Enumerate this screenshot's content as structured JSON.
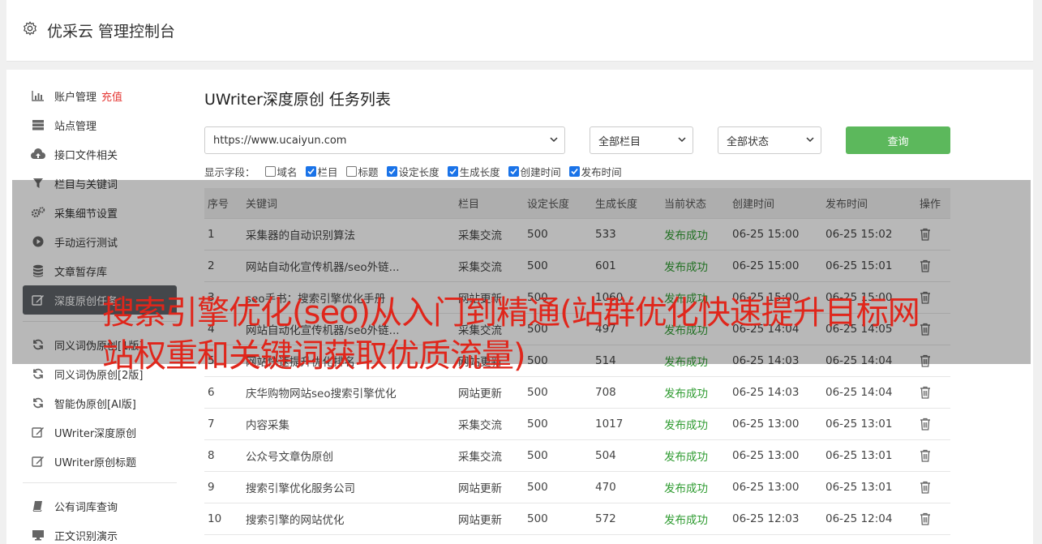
{
  "app": {
    "title": "优采云 管理控制台"
  },
  "sidebar": {
    "items": [
      {
        "label": "账户管理",
        "extra": "充值",
        "icon": "bar-chart-icon"
      },
      {
        "label": "站点管理",
        "icon": "server-icon"
      },
      {
        "label": "接口文件相关",
        "icon": "cloud-upload-icon"
      },
      {
        "label": "栏目与关键词",
        "icon": "filter-icon"
      },
      {
        "label": "采集细节设置",
        "icon": "gears-icon"
      },
      {
        "label": "手动运行测试",
        "icon": "play-circle-icon"
      },
      {
        "label": "文章暂存库",
        "icon": "database-icon"
      },
      {
        "label": "深度原创任务",
        "icon": "edit-icon"
      },
      {
        "label": "同义词伪原创[1版]",
        "icon": "refresh-icon"
      },
      {
        "label": "同义词伪原创[2版]",
        "icon": "refresh-icon"
      },
      {
        "label": "智能伪原创[AI版]",
        "icon": "refresh-icon"
      },
      {
        "label": "UWriter深度原创",
        "icon": "edit-icon"
      },
      {
        "label": "UWriter原创标题",
        "icon": "edit-icon"
      },
      {
        "label": "公有词库查询",
        "icon": "book-icon"
      },
      {
        "label": "正文识别演示",
        "icon": "monitor-icon"
      }
    ]
  },
  "main": {
    "title": "UWriter深度原创 任务列表",
    "site_select": "https://www.ucaiyun.com",
    "column_select": "全部栏目",
    "status_select": "全部状态",
    "query_label": "查询",
    "fields_label": "显示字段：",
    "fields": [
      {
        "label": "域名",
        "checked": false
      },
      {
        "label": "栏目",
        "checked": true
      },
      {
        "label": "标题",
        "checked": false
      },
      {
        "label": "设定长度",
        "checked": true
      },
      {
        "label": "生成长度",
        "checked": true
      },
      {
        "label": "创建时间",
        "checked": true
      },
      {
        "label": "发布时间",
        "checked": true
      }
    ],
    "columns": [
      "序号",
      "关键词",
      "栏目",
      "设定长度",
      "生成长度",
      "当前状态",
      "创建时间",
      "发布时间",
      "操作"
    ],
    "rows": [
      [
        "1",
        "采集器的自动识别算法",
        "采集交流",
        "500",
        "533",
        "发布成功",
        "06-25 15:00",
        "06-25 15:02"
      ],
      [
        "2",
        "网站自动化宣传机器/seo外链...",
        "采集交流",
        "500",
        "601",
        "发布成功",
        "06-25 15:00",
        "06-25 15:01"
      ],
      [
        "3",
        "seo手书：搜索引擎优化手册",
        "网站更新",
        "500",
        "1060",
        "发布成功",
        "06-25 15:00",
        "06-25 15:00"
      ],
      [
        "4",
        "网站自动化宣传机器/seo外链...",
        "采集交流",
        "500",
        "497",
        "发布成功",
        "06-25 14:04",
        "06-25 14:05"
      ],
      [
        "5",
        "网站快速提升优化排名",
        "网站更新",
        "500",
        "514",
        "发布成功",
        "06-25 14:03",
        "06-25 14:04"
      ],
      [
        "6",
        "庆华购物网站seo搜索引擎优化",
        "网站更新",
        "500",
        "708",
        "发布成功",
        "06-25 14:03",
        "06-25 14:04"
      ],
      [
        "7",
        "内容采集",
        "采集交流",
        "500",
        "1017",
        "发布成功",
        "06-25 13:00",
        "06-25 13:01"
      ],
      [
        "8",
        "公众号文章伪原创",
        "采集交流",
        "500",
        "504",
        "发布成功",
        "06-25 13:00",
        "06-25 13:01"
      ],
      [
        "9",
        "搜索引擎优化服务公司",
        "网站更新",
        "500",
        "470",
        "发布成功",
        "06-25 13:00",
        "06-25 13:01"
      ],
      [
        "10",
        "搜索引擎的网站优化",
        "网站更新",
        "500",
        "572",
        "发布成功",
        "06-25 12:03",
        "06-25 12:04"
      ]
    ]
  },
  "overlay": {
    "headline": "搜索引擎优化(seo)从入门到精通(站群优化快速提升目标网站权重和关键词获取优质流量)"
  },
  "colors": {
    "accent_green": "#5cb85c",
    "status_green": "#2e9b30",
    "overlay_red": "#e0261b",
    "active_sidebar": "#5f6368"
  }
}
